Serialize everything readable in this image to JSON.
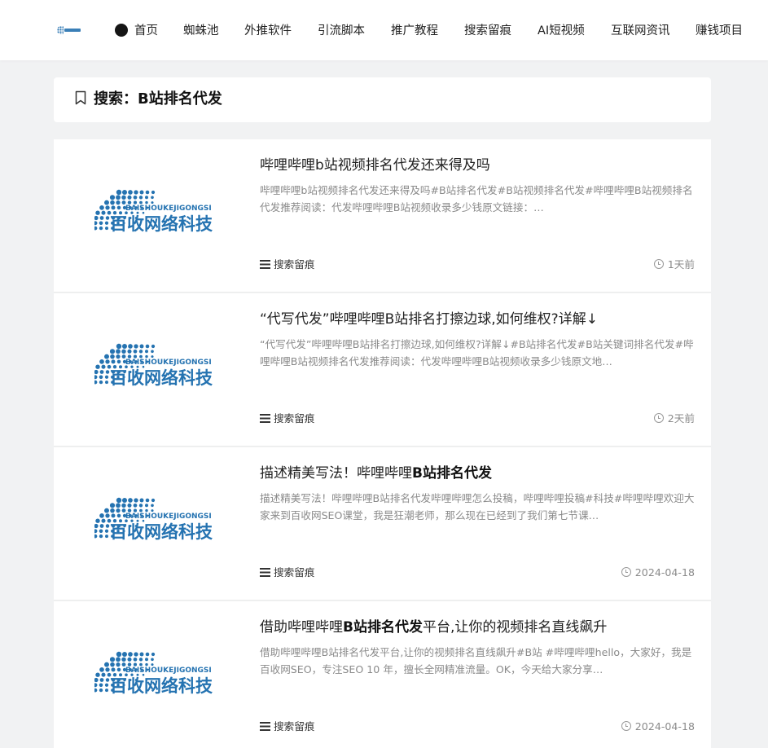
{
  "nav": {
    "items": [
      "首页",
      "蜘蛛池",
      "外推软件",
      "引流脚本",
      "推广教程",
      "搜索留痕",
      "AI短视频",
      "互联网资讯",
      "赚钱项目"
    ]
  },
  "search": {
    "title": "搜索：B站排名代发"
  },
  "thumbnail": {
    "brand_en": "BAISHOUKEJIGONGSI",
    "brand_cn": "百收网络科技",
    "color": "#2573b1"
  },
  "posts": [
    {
      "title_pre": "哔哩哔哩b站视频排名代发还来得及吗",
      "title_bold": "",
      "title_post": "",
      "excerpt": "哔哩哔哩b站视频排名代发还来得及吗#B站排名代发#B站视频排名代发#哔哩哔哩B站视频排名代发推荐阅读：代发哔哩哔哩B站视频收录多少钱原文链接：…",
      "category": "搜索留痕",
      "time": "1天前"
    },
    {
      "title_pre": "“代写代发”哔哩哔哩B站排名打擦边球,如何维权?详解↓",
      "title_bold": "",
      "title_post": "",
      "excerpt": "“代写代发”哔哩哔哩B站排名打擦边球,如何维权?详解↓#B站排名代发#B站关键词排名代发#哔哩哔哩B站视频排名代发推荐阅读：代发哔哩哔哩B站视频收录多少钱原文地…",
      "category": "搜索留痕",
      "time": "2天前"
    },
    {
      "title_pre": "描述精美写法！哔哩哔哩",
      "title_bold": "B站排名代发",
      "title_post": "",
      "excerpt": "描述精美写法！哔哩哔哩B站排名代发哔哩哔哩怎么投稿，哔哩哔哩投稿#科技#哔哩哔哩欢迎大家来到百收网SEO课堂，我是狂潮老师，那么现在已经到了我们第七节课…",
      "category": "搜索留痕",
      "time": "2024-04-18"
    },
    {
      "title_pre": "借助哔哩哔哩",
      "title_bold": "B站排名代发",
      "title_post": "平台,让你的视频排名直线飙升",
      "excerpt": "借助哔哩哔哩B站排名代发平台,让你的视频排名直线飙升#B站 #哔哩哔哩hello，大家好，我是百收网SEO，专注SEO 10 年，擅长全网精准流量。OK，今天给大家分享…",
      "category": "搜索留痕",
      "time": "2024-04-18"
    }
  ]
}
